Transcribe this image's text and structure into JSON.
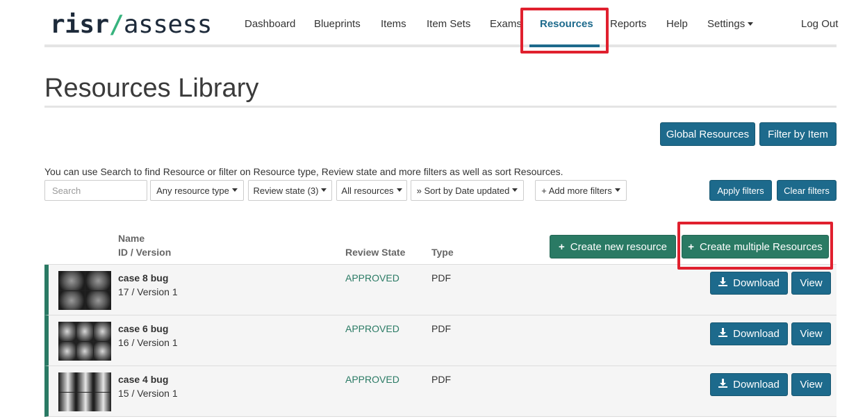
{
  "logo": {
    "part1": "risr",
    "slash": "/",
    "part2": "assess"
  },
  "nav": {
    "items": [
      {
        "label": "Dashboard"
      },
      {
        "label": "Blueprints"
      },
      {
        "label": "Items"
      },
      {
        "label": "Item Sets"
      },
      {
        "label": "Exams"
      },
      {
        "label": "Resources"
      },
      {
        "label": "Reports"
      },
      {
        "label": "Help"
      },
      {
        "label": "Settings"
      }
    ],
    "active": "Resources",
    "logout": "Log Out"
  },
  "page": {
    "title": "Resources Library"
  },
  "top_buttons": {
    "global": "Global Resources",
    "filter_item": "Filter by Item"
  },
  "filters": {
    "help_text": "You can use Search to find Resource or filter on Resource type, Review state and more filters as well as sort Resources.",
    "search_placeholder": "Search",
    "resource_type": "Any resource type",
    "review_state": "Review state (3)",
    "all_resources": "All resources",
    "sort": "» Sort by Date updated",
    "add_filters": "+ Add more filters",
    "apply": "Apply filters",
    "clear": "Clear filters"
  },
  "table": {
    "col_name": "Name",
    "col_id": "ID / Version",
    "col_state": "Review State",
    "col_type": "Type",
    "create_new": "Create new resource",
    "create_multiple": "Create multiple Resources",
    "rows": [
      {
        "name": "case 8 bug",
        "id_version": "17 / Version 1",
        "state": "APPROVED",
        "type": "PDF",
        "download": "Download",
        "view": "View"
      },
      {
        "name": "case 6 bug",
        "id_version": "16 / Version 1",
        "state": "APPROVED",
        "type": "PDF",
        "download": "Download",
        "view": "View"
      },
      {
        "name": "case 4 bug",
        "id_version": "15 / Version 1",
        "state": "APPROVED",
        "type": "PDF",
        "download": "Download",
        "view": "View"
      }
    ]
  },
  "icons": {
    "plus": "plus-icon",
    "download": "download-icon",
    "caret": "caret-down-icon"
  },
  "colors": {
    "primary": "#1d6a8c",
    "success": "#2a7a64",
    "approved": "#2a7a64",
    "highlight": "#e0202e"
  }
}
